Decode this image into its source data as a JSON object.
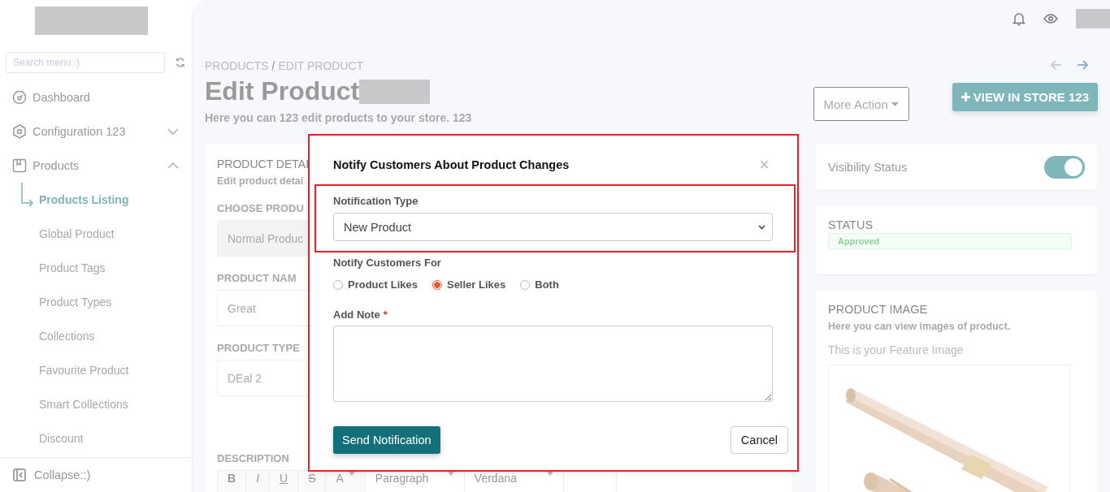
{
  "sidebar": {
    "search": {
      "placeholder": "Search menu::)"
    },
    "items": [
      {
        "label": "Dashboard"
      },
      {
        "label": "Configuration 123",
        "expanded": false
      },
      {
        "label": "Products",
        "expanded": true,
        "children": [
          {
            "label": "Products Listing",
            "selected": true
          },
          {
            "label": "Global Product",
            "selected": false
          },
          {
            "label": "Product Tags",
            "selected": false
          },
          {
            "label": "Product Types",
            "selected": false
          },
          {
            "label": "Collections",
            "selected": false
          },
          {
            "label": "Favourite Product",
            "selected": false
          },
          {
            "label": "Smart Collections",
            "selected": false
          },
          {
            "label": "Discount",
            "selected": false
          }
        ]
      }
    ],
    "collapse": "Collapse::)"
  },
  "breadcrumb": {
    "items": [
      "PRODUCTS",
      "EDIT PRODUCT"
    ],
    "separator": "/"
  },
  "title": "Edit Product",
  "subtitle": "Here you can 123 edit products to your store. 123",
  "actions": {
    "more": "More Action",
    "view_store": "VIEW IN STORE 123"
  },
  "details": {
    "title": "PRODUCT DETAI",
    "subtitle": "Edit product detai",
    "fields": [
      {
        "label": "CHOOSE PRODU",
        "value": "Normal Produc",
        "disabled": true
      },
      {
        "label": "PRODUCT NAM",
        "value": "Great",
        "disabled": false
      },
      {
        "label": "PRODUCT TYPE",
        "value": "DEal 2",
        "disabled": false
      }
    ],
    "description": "DESCRIPTION",
    "toolbar": [
      {
        "label": "B",
        "kind": "bold"
      },
      {
        "label": "I",
        "kind": "italic"
      },
      {
        "label": "U",
        "kind": "underline"
      },
      {
        "label": "S",
        "kind": "strike"
      },
      {
        "label": "A",
        "kind": "color"
      },
      {
        "label": "Paragraph",
        "kind": "dropdown"
      },
      {
        "label": "Verdana",
        "kind": "dropdown"
      }
    ]
  },
  "visibility": {
    "label": "Visibility Status",
    "on": true
  },
  "status": {
    "title": "STATUS",
    "badge": "Approved"
  },
  "image": {
    "title": "PRODUCT IMAGE",
    "subtitle": "Here you can view images of product.",
    "caption": "This is your Feature Image"
  },
  "modal": {
    "title": "Notify Customers About Product Changes",
    "close": "×",
    "type_label": "Notification Type",
    "type_value": "New Product",
    "for_label": "Notify Customers For",
    "options": [
      {
        "label": "Product Likes",
        "selected": false
      },
      {
        "label": "Seller Likes",
        "selected": true
      },
      {
        "label": "Both",
        "selected": false
      }
    ],
    "note_label": "Add Note",
    "required": "*",
    "send": "Send Notification",
    "cancel": "Cancel"
  }
}
